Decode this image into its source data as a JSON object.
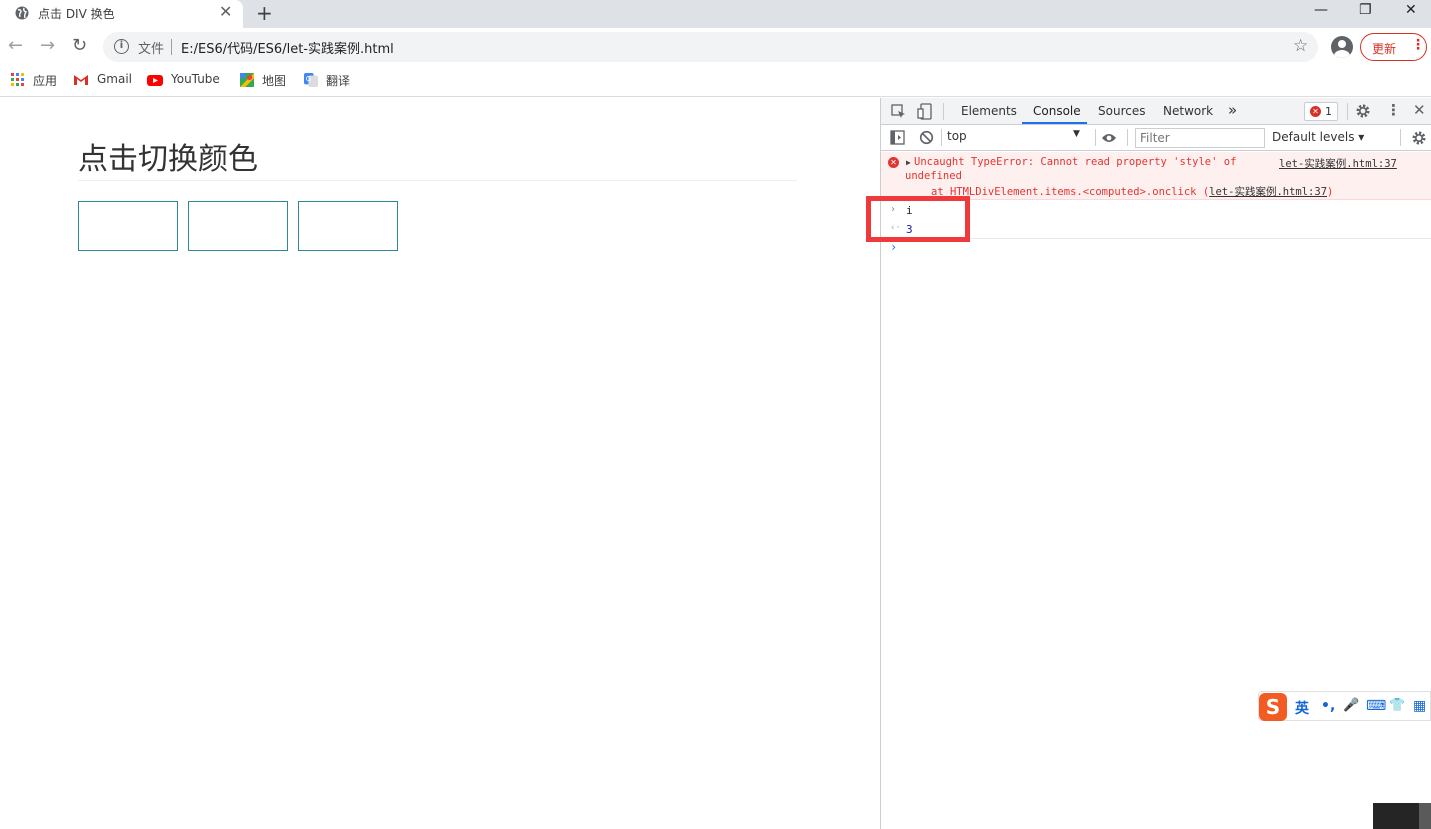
{
  "tab": {
    "title": "点击 DIV 换色",
    "close_glyph": "✕"
  },
  "new_tab_glyph": "+",
  "window_controls": {
    "minimize": "—",
    "restore": "❐",
    "close": "✕"
  },
  "toolbar": {
    "back": "←",
    "forward": "→",
    "reload": "↻",
    "scheme_label": "文件",
    "url": "E:/ES6/代码/ES6/let-实践案例.html",
    "star": "☆",
    "update_label": "更新",
    "menu_glyph": "⋮"
  },
  "bookmarks": [
    {
      "label": "应用",
      "icon": "apps-grid-icon"
    },
    {
      "label": "Gmail",
      "icon": "gmail-icon"
    },
    {
      "label": "YouTube",
      "icon": "youtube-icon"
    },
    {
      "label": "地图",
      "icon": "maps-icon"
    },
    {
      "label": "翻译",
      "icon": "translate-icon"
    }
  ],
  "page": {
    "heading": "点击切换颜色",
    "boxes": 3,
    "box_border_color": "#2d8a94"
  },
  "devtools": {
    "tabs": [
      "Elements",
      "Console",
      "Sources",
      "Network"
    ],
    "active_tab": "Console",
    "more_tabs": "»",
    "error_count": "1",
    "context": "top",
    "filter_placeholder": "Filter",
    "levels": "Default levels ▾",
    "error": {
      "line1": "Uncaught TypeError: Cannot read property 'style' of",
      "line2": "undefined",
      "line3_prefix": "at HTMLDivElement.items.<computed>.onclick (",
      "line3_link": "let-实践案例.html:37",
      "line3_suffix": ")",
      "source": "let-实践案例.html:37"
    },
    "input": {
      "chevron": "›",
      "text": "i"
    },
    "output": {
      "chevron": "‹·",
      "text": "3"
    },
    "prompt_chevron": "›"
  },
  "ime": {
    "logo": "S",
    "items": [
      "英",
      "•,",
      "🎤",
      "⌨",
      "👕",
      "▦"
    ]
  },
  "colors": {
    "highlight": "#f0393a",
    "error_text": "#e3342f",
    "accent": "#1a73e8"
  }
}
